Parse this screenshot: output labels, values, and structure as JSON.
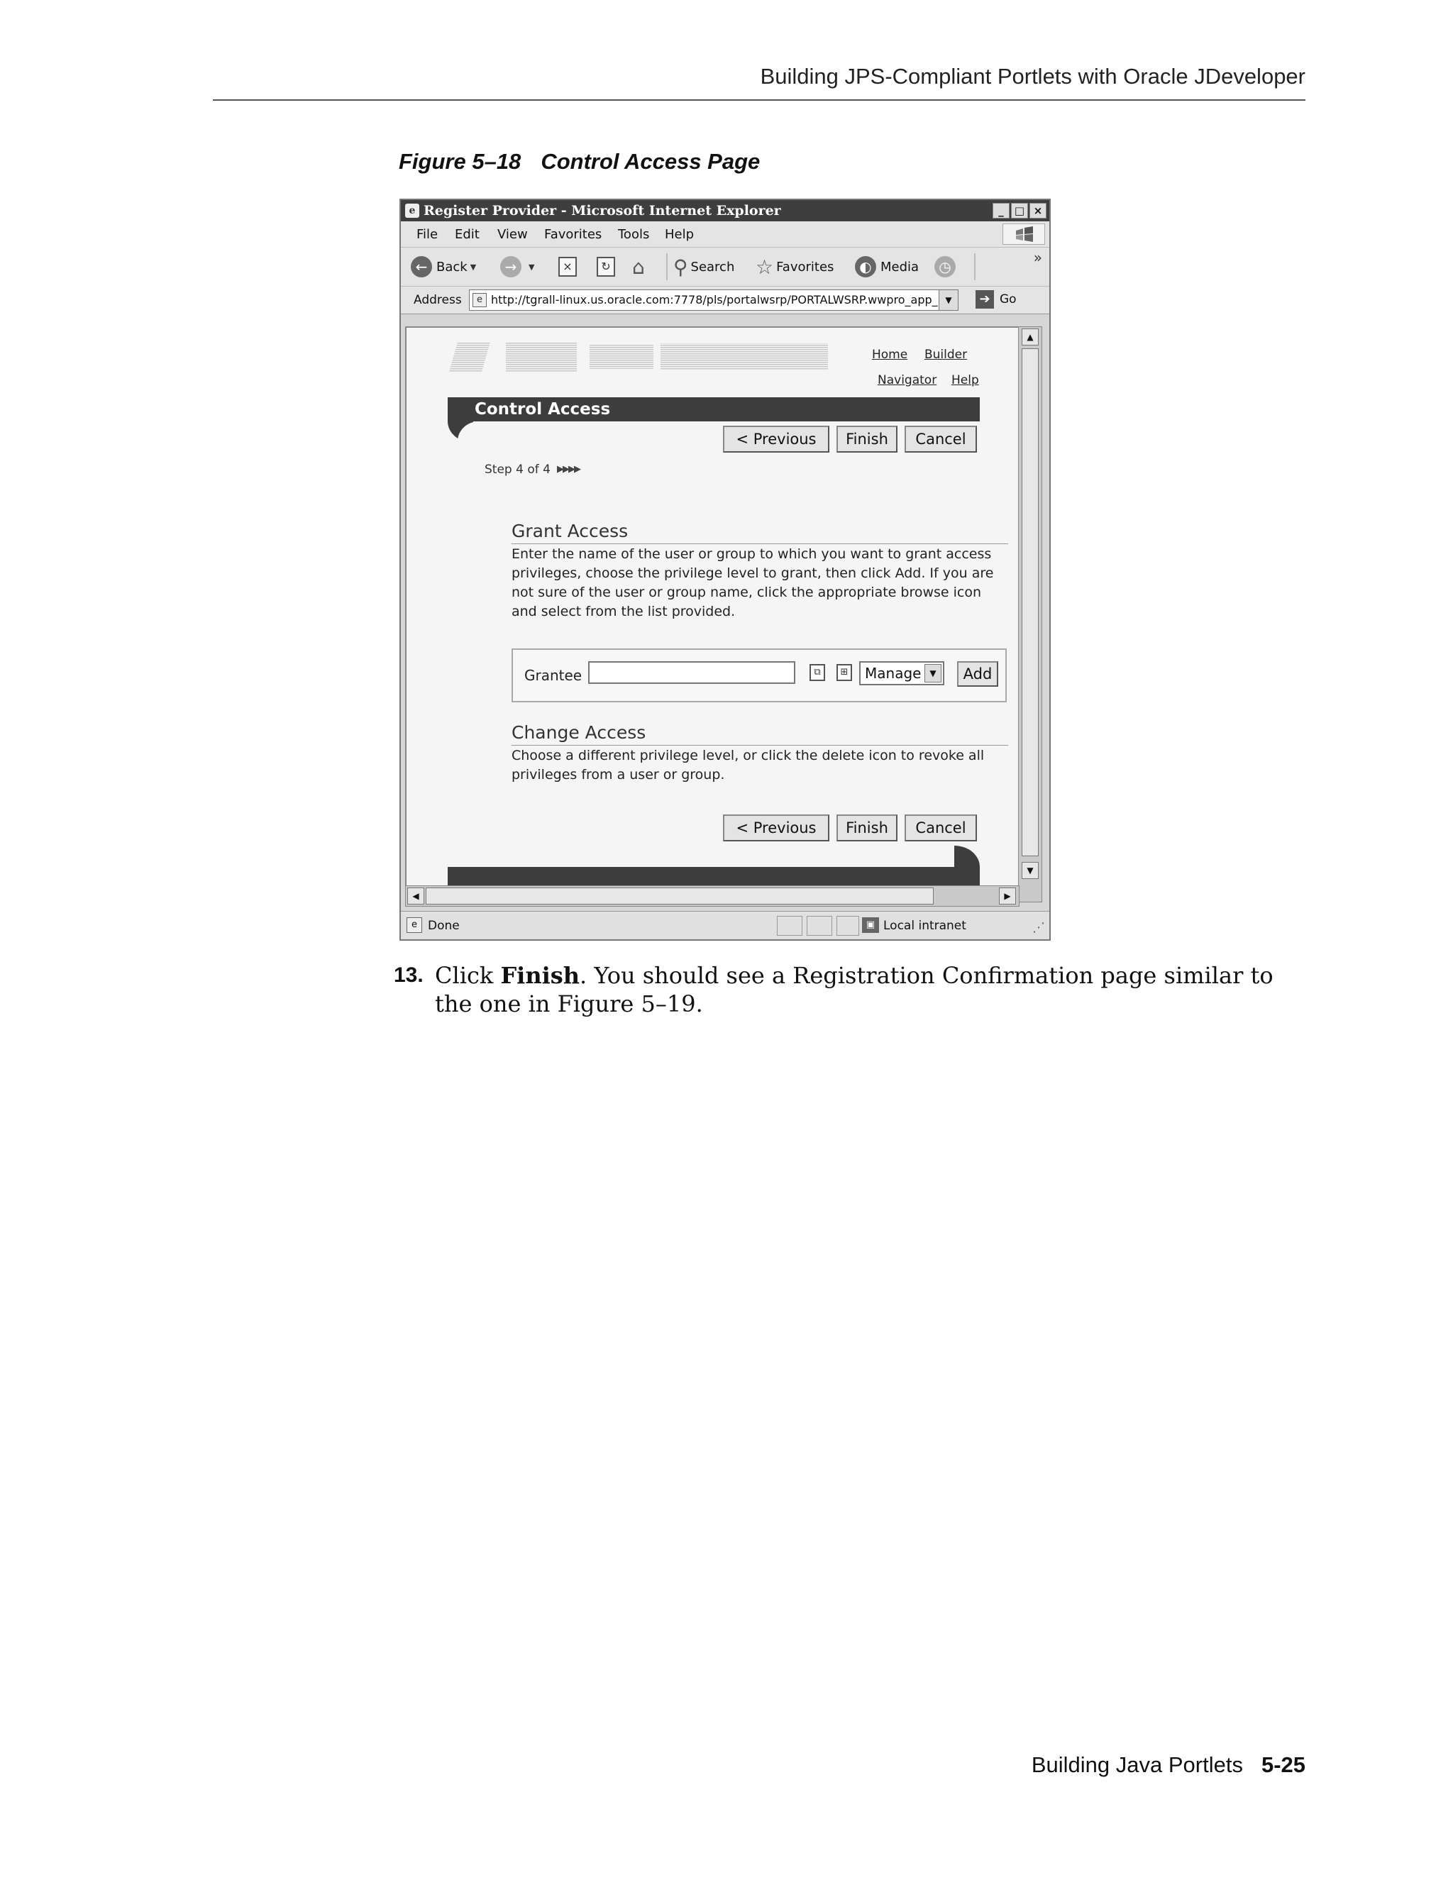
{
  "running_header": "Building JPS-Compliant Portlets with Oracle JDeveloper",
  "figure": {
    "number": "Figure 5–18",
    "title": "Control Access Page"
  },
  "browser": {
    "window_title": "Register Provider - Microsoft Internet Explorer",
    "window_buttons": [
      "_",
      "□",
      "×"
    ],
    "menu": [
      "File",
      "Edit",
      "View",
      "Favorites",
      "Tools",
      "Help"
    ],
    "toolbar": {
      "back": "Back",
      "search": "Search",
      "favorites": "Favorites",
      "media": "Media"
    },
    "address_label": "Address",
    "url": "http://tgrall-linux.us.oracle.com:7778/pls/portalwsrp/PORTALWSRP.wwpro_app_",
    "go_label": "Go",
    "status_text": "Done",
    "zone_text": "Local intranet"
  },
  "portal": {
    "links": {
      "home": "Home",
      "builder": "Builder",
      "navigator": "Navigator",
      "help": "Help"
    },
    "header_title": "Control Access",
    "buttons": {
      "previous": "< Previous",
      "finish": "Finish",
      "cancel": "Cancel"
    },
    "step_text": "Step 4 of 4",
    "grant_access": {
      "title": "Grant Access",
      "text": "Enter the name of the user or group to which you want to grant access privileges, choose the privilege level to grant, then click Add. If you are not sure of the user or group name, click the appropriate browse icon and select from the list provided.",
      "grantee_label": "Grantee",
      "grantee_value": "",
      "privilege_selected": "Manage",
      "add_label": "Add"
    },
    "change_access": {
      "title": "Change Access",
      "text": "Choose a different privilege level, or click the delete icon to revoke all privileges from a user or group."
    }
  },
  "step13": {
    "number": "13.",
    "text_before": "Click ",
    "bold": "Finish",
    "text_after": ". You should see a Registration Confirmation page similar to the one in Figure 5–19."
  },
  "running_footer": {
    "title": "Building Java Portlets",
    "page": "5-25"
  }
}
